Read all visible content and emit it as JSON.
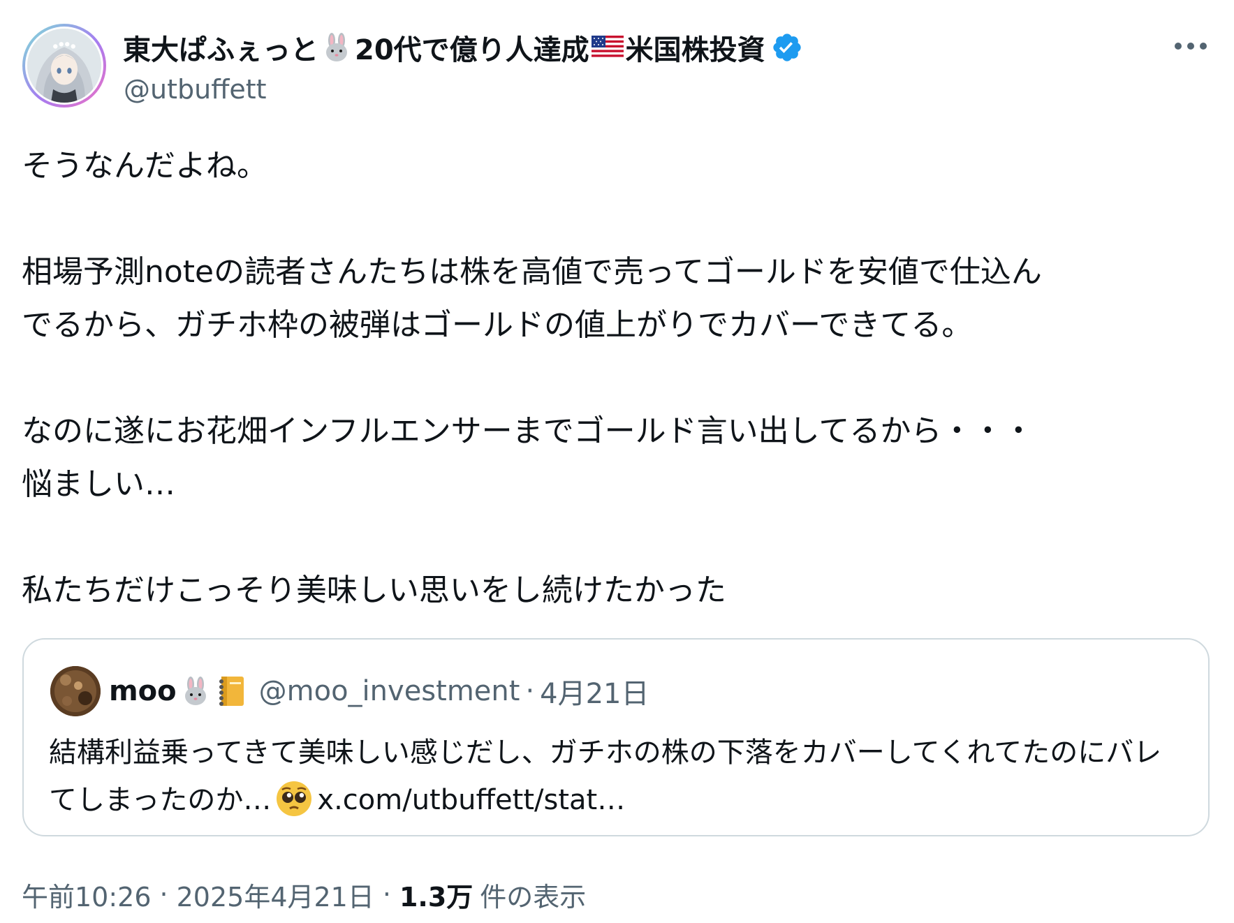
{
  "author": {
    "name_part1": "東大ぱふぇっと",
    "name_part2": "20代で億り人達成",
    "name_part3": "米国株投資",
    "handle": "@utbuffett"
  },
  "icons": {
    "avatar": "avatar-image",
    "rabbit": "rabbit-face-icon",
    "flag": "us-flag-icon",
    "verified": "verified-badge-icon",
    "more": "more-horizontal-icon",
    "notebook": "notebook-icon",
    "pleading": "pleading-face-icon"
  },
  "colors": {
    "text": "#0f1419",
    "secondary": "#536471",
    "verified": "#1d9bf0",
    "border": "#cfd9de"
  },
  "tweet": {
    "text": "そうなんだよね。\n\n相場予測noteの読者さんたちは株を高値で売ってゴールドを安値で仕込ん\nでるから、ガチホ枠の被弾はゴールドの値上がりでカバーできてる。\n\nなのに遂にお花畑インフルエンサーまでゴールド言い出してるから・・・\n悩ましい…\n\n私たちだけこっそり美味しい思いをし続けたかった"
  },
  "quote": {
    "name": "moo",
    "handle": "@moo_investment",
    "separator": "·",
    "date": "4月21日",
    "text_part1": "結構利益乗ってきて美味しい感じだし、ガチホの株の下落をカバーしてくれてたのにバレてしまったのか…",
    "link": "x.com/utbuffett/stat…"
  },
  "meta": {
    "time": "午前10:26",
    "sep": "·",
    "date": "2025年4月21日",
    "views_count": "1.3万",
    "views_label": "件の表示"
  }
}
